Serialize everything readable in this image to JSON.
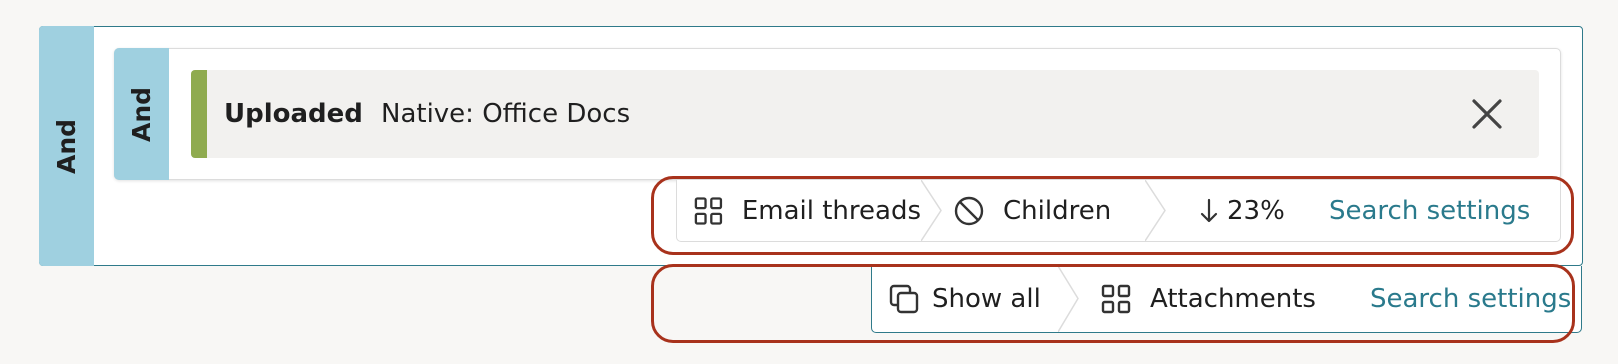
{
  "groups": {
    "outer_operator": "And",
    "inner_operator": "And"
  },
  "condition": {
    "field": "Uploaded",
    "value": "Native: Office Docs",
    "remove_icon": "close-icon",
    "accent_color": "#8fab4f"
  },
  "bar1": {
    "email_threads": "Email threads",
    "email_threads_icon": "grid-icon",
    "children": "Children",
    "children_icon": "prohibited-icon",
    "percent": "23%",
    "percent_icon": "arrow-down-icon",
    "search_settings": "Search settings"
  },
  "bar2": {
    "show_all": "Show all",
    "show_all_icon": "copy-icon",
    "attachments": "Attachments",
    "attachments_icon": "grid-icon",
    "search_settings": "Search settings"
  },
  "colors": {
    "operator_band": "#9fd0e0",
    "link": "#2a7a8c",
    "highlight": "#a8321c",
    "group_border": "#2f7a8a"
  }
}
